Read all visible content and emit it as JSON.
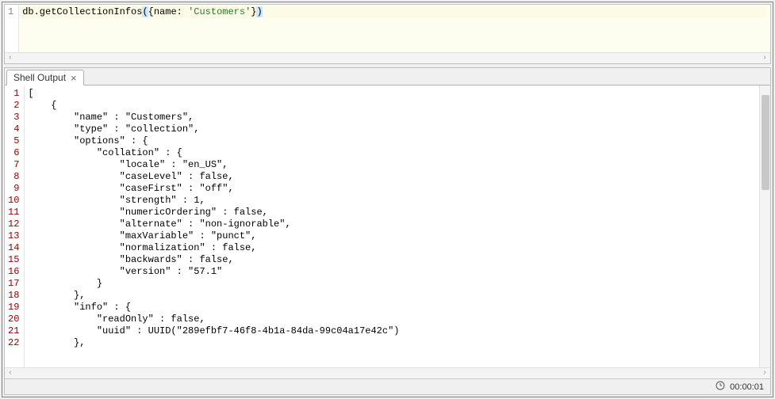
{
  "editor": {
    "line_number": "1",
    "prefix": "db.getCollectionInfos",
    "open_paren": "(",
    "open_brace": "{",
    "key": "name",
    "colon_space": ": ",
    "string_value": "'Customers'",
    "close_brace": "}",
    "close_paren": ")"
  },
  "scroll": {
    "left_arrow": "‹",
    "right_arrow": "›"
  },
  "tab": {
    "label": "Shell Output",
    "close_glyph": "×"
  },
  "output": {
    "line_numbers": [
      "1",
      "2",
      "3",
      "4",
      "5",
      "6",
      "7",
      "8",
      "9",
      "10",
      "11",
      "12",
      "13",
      "14",
      "15",
      "16",
      "17",
      "18",
      "19",
      "20",
      "21",
      "22"
    ],
    "lines": [
      "[",
      "    {",
      "        \"name\" : \"Customers\",",
      "        \"type\" : \"collection\",",
      "        \"options\" : {",
      "            \"collation\" : {",
      "                \"locale\" : \"en_US\",",
      "                \"caseLevel\" : false,",
      "                \"caseFirst\" : \"off\",",
      "                \"strength\" : 1,",
      "                \"numericOrdering\" : false,",
      "                \"alternate\" : \"non-ignorable\",",
      "                \"maxVariable\" : \"punct\",",
      "                \"normalization\" : false,",
      "                \"backwards\" : false,",
      "                \"version\" : \"57.1\"",
      "            }",
      "        },",
      "        \"info\" : {",
      "            \"readOnly\" : false,",
      "            \"uuid\" : UUID(\"289efbf7-46f8-4b1a-84da-99c04a17e42c\")",
      "        },"
    ]
  },
  "status": {
    "elapsed": "00:00:01"
  }
}
